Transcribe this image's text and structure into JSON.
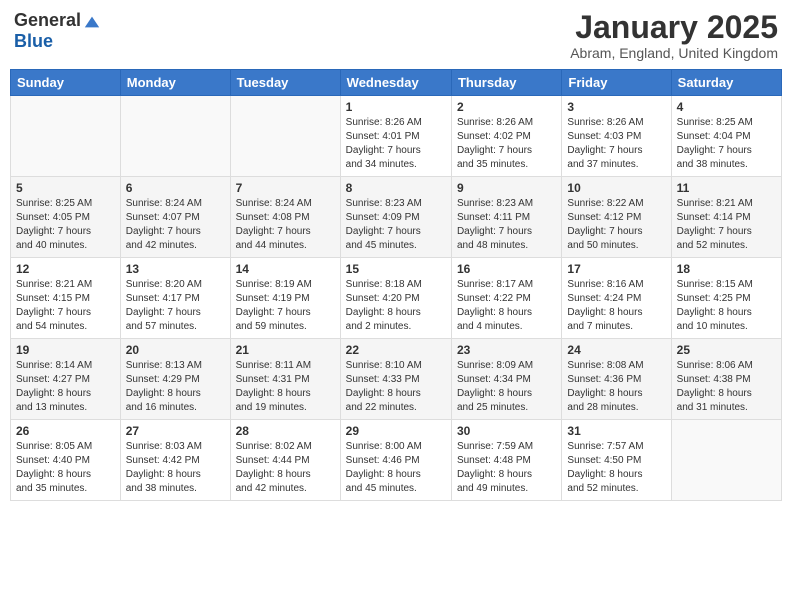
{
  "header": {
    "logo_general": "General",
    "logo_blue": "Blue",
    "month": "January 2025",
    "location": "Abram, England, United Kingdom"
  },
  "days_of_week": [
    "Sunday",
    "Monday",
    "Tuesday",
    "Wednesday",
    "Thursday",
    "Friday",
    "Saturday"
  ],
  "weeks": [
    [
      {
        "day": "",
        "info": ""
      },
      {
        "day": "",
        "info": ""
      },
      {
        "day": "",
        "info": ""
      },
      {
        "day": "1",
        "info": "Sunrise: 8:26 AM\nSunset: 4:01 PM\nDaylight: 7 hours\nand 34 minutes."
      },
      {
        "day": "2",
        "info": "Sunrise: 8:26 AM\nSunset: 4:02 PM\nDaylight: 7 hours\nand 35 minutes."
      },
      {
        "day": "3",
        "info": "Sunrise: 8:26 AM\nSunset: 4:03 PM\nDaylight: 7 hours\nand 37 minutes."
      },
      {
        "day": "4",
        "info": "Sunrise: 8:25 AM\nSunset: 4:04 PM\nDaylight: 7 hours\nand 38 minutes."
      }
    ],
    [
      {
        "day": "5",
        "info": "Sunrise: 8:25 AM\nSunset: 4:05 PM\nDaylight: 7 hours\nand 40 minutes."
      },
      {
        "day": "6",
        "info": "Sunrise: 8:24 AM\nSunset: 4:07 PM\nDaylight: 7 hours\nand 42 minutes."
      },
      {
        "day": "7",
        "info": "Sunrise: 8:24 AM\nSunset: 4:08 PM\nDaylight: 7 hours\nand 44 minutes."
      },
      {
        "day": "8",
        "info": "Sunrise: 8:23 AM\nSunset: 4:09 PM\nDaylight: 7 hours\nand 45 minutes."
      },
      {
        "day": "9",
        "info": "Sunrise: 8:23 AM\nSunset: 4:11 PM\nDaylight: 7 hours\nand 48 minutes."
      },
      {
        "day": "10",
        "info": "Sunrise: 8:22 AM\nSunset: 4:12 PM\nDaylight: 7 hours\nand 50 minutes."
      },
      {
        "day": "11",
        "info": "Sunrise: 8:21 AM\nSunset: 4:14 PM\nDaylight: 7 hours\nand 52 minutes."
      }
    ],
    [
      {
        "day": "12",
        "info": "Sunrise: 8:21 AM\nSunset: 4:15 PM\nDaylight: 7 hours\nand 54 minutes."
      },
      {
        "day": "13",
        "info": "Sunrise: 8:20 AM\nSunset: 4:17 PM\nDaylight: 7 hours\nand 57 minutes."
      },
      {
        "day": "14",
        "info": "Sunrise: 8:19 AM\nSunset: 4:19 PM\nDaylight: 7 hours\nand 59 minutes."
      },
      {
        "day": "15",
        "info": "Sunrise: 8:18 AM\nSunset: 4:20 PM\nDaylight: 8 hours\nand 2 minutes."
      },
      {
        "day": "16",
        "info": "Sunrise: 8:17 AM\nSunset: 4:22 PM\nDaylight: 8 hours\nand 4 minutes."
      },
      {
        "day": "17",
        "info": "Sunrise: 8:16 AM\nSunset: 4:24 PM\nDaylight: 8 hours\nand 7 minutes."
      },
      {
        "day": "18",
        "info": "Sunrise: 8:15 AM\nSunset: 4:25 PM\nDaylight: 8 hours\nand 10 minutes."
      }
    ],
    [
      {
        "day": "19",
        "info": "Sunrise: 8:14 AM\nSunset: 4:27 PM\nDaylight: 8 hours\nand 13 minutes."
      },
      {
        "day": "20",
        "info": "Sunrise: 8:13 AM\nSunset: 4:29 PM\nDaylight: 8 hours\nand 16 minutes."
      },
      {
        "day": "21",
        "info": "Sunrise: 8:11 AM\nSunset: 4:31 PM\nDaylight: 8 hours\nand 19 minutes."
      },
      {
        "day": "22",
        "info": "Sunrise: 8:10 AM\nSunset: 4:33 PM\nDaylight: 8 hours\nand 22 minutes."
      },
      {
        "day": "23",
        "info": "Sunrise: 8:09 AM\nSunset: 4:34 PM\nDaylight: 8 hours\nand 25 minutes."
      },
      {
        "day": "24",
        "info": "Sunrise: 8:08 AM\nSunset: 4:36 PM\nDaylight: 8 hours\nand 28 minutes."
      },
      {
        "day": "25",
        "info": "Sunrise: 8:06 AM\nSunset: 4:38 PM\nDaylight: 8 hours\nand 31 minutes."
      }
    ],
    [
      {
        "day": "26",
        "info": "Sunrise: 8:05 AM\nSunset: 4:40 PM\nDaylight: 8 hours\nand 35 minutes."
      },
      {
        "day": "27",
        "info": "Sunrise: 8:03 AM\nSunset: 4:42 PM\nDaylight: 8 hours\nand 38 minutes."
      },
      {
        "day": "28",
        "info": "Sunrise: 8:02 AM\nSunset: 4:44 PM\nDaylight: 8 hours\nand 42 minutes."
      },
      {
        "day": "29",
        "info": "Sunrise: 8:00 AM\nSunset: 4:46 PM\nDaylight: 8 hours\nand 45 minutes."
      },
      {
        "day": "30",
        "info": "Sunrise: 7:59 AM\nSunset: 4:48 PM\nDaylight: 8 hours\nand 49 minutes."
      },
      {
        "day": "31",
        "info": "Sunrise: 7:57 AM\nSunset: 4:50 PM\nDaylight: 8 hours\nand 52 minutes."
      },
      {
        "day": "",
        "info": ""
      }
    ]
  ]
}
